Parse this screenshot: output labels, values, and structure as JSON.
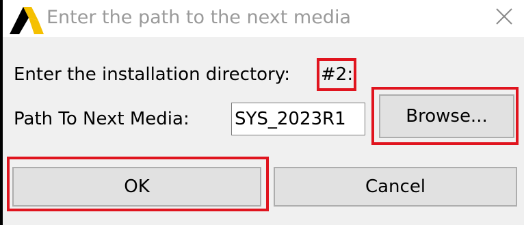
{
  "titlebar": {
    "title": "Enter the path to the next media",
    "app_icon": "ansys-logo-icon",
    "close_icon": "close-icon"
  },
  "form": {
    "installation_label": "Enter the installation directory:",
    "installation_value": "#2:",
    "path_label": "Path To Next Media:",
    "path_value": "SYS_2023R1"
  },
  "buttons": {
    "browse_label": "Browse...",
    "ok_label": "OK",
    "cancel_label": "Cancel"
  },
  "colors": {
    "highlight": "#e0141e",
    "window_bg": "#f0f0f0",
    "button_bg": "#e1e1e1",
    "title_text": "#9a9a9a"
  }
}
